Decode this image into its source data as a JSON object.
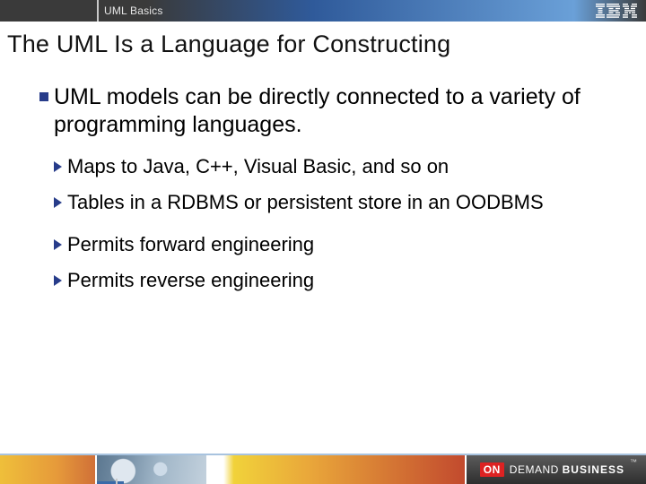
{
  "header": {
    "breadcrumb": "UML Basics",
    "logo_name": "ibm-logo"
  },
  "title": "The UML Is a Language for Constructing",
  "bullets": [
    {
      "text": "UML models can be directly connected to a variety of programming languages.",
      "sub": [
        "Maps to Java, C++, Visual Basic, and so on",
        "Tables in a RDBMS or persistent store in an OODBMS",
        "Permits forward engineering",
        "Permits reverse engineering"
      ]
    }
  ],
  "footer": {
    "badge": "ON",
    "brand_light": "DEMAND ",
    "brand_bold": "BUSINESS",
    "tm": "™"
  },
  "colors": {
    "accent": "#273c8a"
  }
}
